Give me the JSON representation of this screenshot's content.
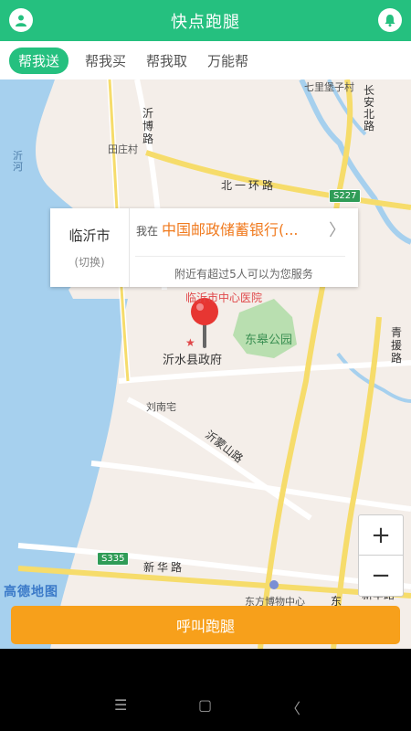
{
  "header": {
    "title": "快点跑腿",
    "left_icon": "user-icon",
    "right_icon": "bell-icon"
  },
  "tabs": [
    {
      "label": "帮我送",
      "active": true
    },
    {
      "label": "帮我买",
      "active": false
    },
    {
      "label": "帮我取",
      "active": false
    },
    {
      "label": "万能帮",
      "active": false
    }
  ],
  "map": {
    "labels": {
      "qiqu": "七里堡子村",
      "changan": "长安北路",
      "yibo": "沂博路",
      "tianzhuang": "田庄村",
      "yihe": "沂河",
      "beiyi": "北一环路",
      "s227": "S227",
      "hospital": "临沂市中心医院",
      "park": "东皋公园",
      "gov": "沂水县政府",
      "qingyuan": "青援路",
      "liunan": "刘南宅",
      "yimeng": "沂蒙山路",
      "s335": "S335",
      "xinhua": "新华路",
      "museum": "东方博物中心",
      "dong": "东",
      "xinhua_r": "新华路"
    },
    "logo": "高德地图",
    "zoom_in": "+",
    "zoom_out": "−"
  },
  "location_card": {
    "city": "临沂市",
    "switch": "(切换)",
    "prefix": "我在",
    "place": "中国邮政储蓄银行(...",
    "nearby": "附近有超过5人可以为您服务"
  },
  "call_button": {
    "label": "呼叫跑腿"
  },
  "navbar": {
    "menu": "☰",
    "home": "▢",
    "back": "〈"
  },
  "colors": {
    "brand": "#25c07f",
    "accent": "#f7a01b",
    "place": "#f07a1e"
  }
}
